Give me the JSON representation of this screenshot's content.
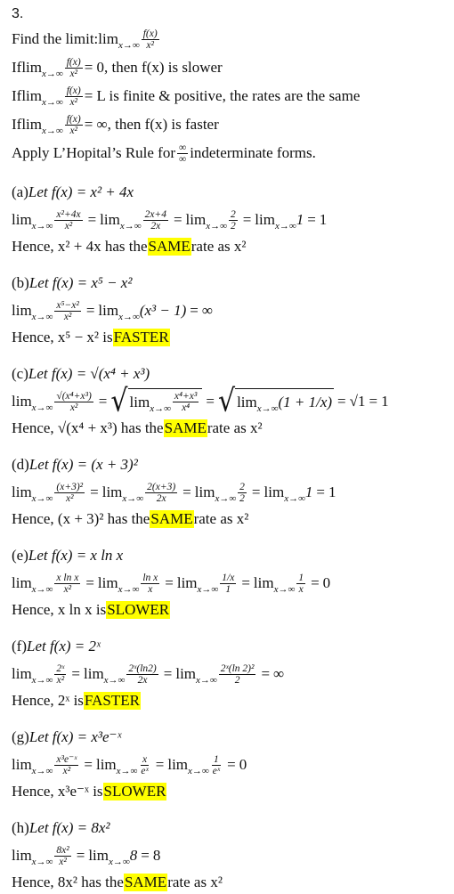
{
  "problem_number": "3.",
  "intro": {
    "find_prefix": "Find the limit: ",
    "lim": "lim",
    "lim_sub": "x→∞",
    "frac_num": "f(x)",
    "frac_den": "x²"
  },
  "rules": [
    {
      "prefix": "If ",
      "lim": "lim",
      "lim_sub": "x→∞",
      "num": "f(x)",
      "den": "x²",
      "result": "= 0, then f(x) is slower"
    },
    {
      "prefix": "If ",
      "lim": "lim",
      "lim_sub": "x→∞",
      "num": "f(x)",
      "den": "x²",
      "result": "= L is finite & positive, the rates are the same"
    },
    {
      "prefix": "If ",
      "lim": "lim",
      "lim_sub": "x→∞",
      "num": "f(x)",
      "den": "x²",
      "result": "= ∞, then f(x) is faster"
    }
  ],
  "lhopital": {
    "prefix": "Apply L’Hopital’s Rule for ",
    "num": "∞",
    "den": "∞",
    "suffix": " indeterminate forms."
  },
  "parts": [
    {
      "label": "(a)",
      "let": "Let f(x) = x² + 4x",
      "steps": [
        {
          "type": "limfrac",
          "num": "x²+4x",
          "den": "x²"
        },
        {
          "type": "limfrac",
          "num": "2x+4",
          "den": "2x"
        },
        {
          "type": "limfrac",
          "num": "2",
          "den": "2"
        },
        {
          "type": "limexpr",
          "expr": "1"
        },
        {
          "type": "value",
          "expr": "1"
        }
      ],
      "hence_prefix": "Hence, x² + 4x has the ",
      "verdict": "SAME",
      "hence_suffix": " rate as x²"
    },
    {
      "label": "(b)",
      "let": "Let f(x) = x⁵ − x²",
      "steps": [
        {
          "type": "limfrac",
          "num": "x⁵−x²",
          "den": "x²"
        },
        {
          "type": "limexpr",
          "expr": "(x³ − 1)"
        },
        {
          "type": "value",
          "expr": "∞"
        }
      ],
      "hence_prefix": "Hence, x⁵ − x² is ",
      "verdict": "FASTER",
      "hence_suffix": ""
    },
    {
      "label": "(c)",
      "let": "Let f(x) = √(x⁴ + x³)",
      "steps": [
        {
          "type": "limfrac",
          "num": "√(x⁴+x³)",
          "den": "x²"
        },
        {
          "type": "sqrtlimfrac",
          "num": "x⁴+x³",
          "den": "x⁴"
        },
        {
          "type": "sqrtlimexpr",
          "expr": "(1 + 1/x)"
        },
        {
          "type": "value",
          "expr": "√1"
        },
        {
          "type": "value",
          "expr": "1"
        }
      ],
      "hence_prefix": "Hence, √(x⁴ + x³) has the ",
      "verdict": "SAME",
      "hence_suffix": " rate as x²"
    },
    {
      "label": "(d)",
      "let": "Let f(x) = (x + 3)²",
      "steps": [
        {
          "type": "limfrac",
          "num": "(x+3)²",
          "den": "x²"
        },
        {
          "type": "limfrac",
          "num": "2(x+3)",
          "den": "2x"
        },
        {
          "type": "limfrac",
          "num": "2",
          "den": "2"
        },
        {
          "type": "limexpr",
          "expr": "1"
        },
        {
          "type": "value",
          "expr": "1"
        }
      ],
      "hence_prefix": "Hence, (x + 3)² has the ",
      "verdict": "SAME",
      "hence_suffix": " rate as x²"
    },
    {
      "label": "(e)",
      "let": "Let f(x) = x ln x",
      "steps": [
        {
          "type": "limfrac",
          "num": "x ln x",
          "den": "x²"
        },
        {
          "type": "limfrac",
          "num": "ln x",
          "den": "x"
        },
        {
          "type": "limfrac",
          "num": "1/x",
          "den": "1"
        },
        {
          "type": "limfrac",
          "num": "1",
          "den": "x"
        },
        {
          "type": "value",
          "expr": "0"
        }
      ],
      "hence_prefix": "Hence, x ln x is ",
      "verdict": "SLOWER",
      "hence_suffix": ""
    },
    {
      "label": "(f)",
      "let": "Let f(x) = 2ˣ",
      "steps": [
        {
          "type": "limfrac",
          "num": "2ˣ",
          "den": "x²"
        },
        {
          "type": "limfrac",
          "num": "2ˣ(ln2)",
          "den": "2x"
        },
        {
          "type": "limfrac",
          "num": "2ˣ(ln 2)²",
          "den": "2"
        },
        {
          "type": "value",
          "expr": "∞"
        }
      ],
      "hence_prefix": "Hence, 2ˣ is ",
      "verdict": "FASTER",
      "hence_suffix": ""
    },
    {
      "label": "(g)",
      "let": "Let f(x) = x³e⁻ˣ",
      "steps": [
        {
          "type": "limfrac",
          "num": "x³e⁻ˣ",
          "den": "x²"
        },
        {
          "type": "limfrac",
          "num": "x",
          "den": "eˣ"
        },
        {
          "type": "limfrac",
          "num": "1",
          "den": "eˣ"
        },
        {
          "type": "value",
          "expr": "0"
        }
      ],
      "hence_prefix": "Hence, x³e⁻ˣ is ",
      "verdict": "SLOWER",
      "hence_suffix": ""
    },
    {
      "label": "(h)",
      "let": "Let f(x) = 8x²",
      "steps": [
        {
          "type": "limfrac",
          "num": "8x²",
          "den": "x²"
        },
        {
          "type": "limexpr",
          "expr": "8"
        },
        {
          "type": "value",
          "expr": "8"
        }
      ],
      "hence_prefix": "Hence, 8x² has the ",
      "verdict": "SAME",
      "hence_suffix": " rate as x²"
    }
  ],
  "lim_word": "lim",
  "lim_sub": "x→∞",
  "equals": "=",
  "highlight_color": "#ffff00"
}
